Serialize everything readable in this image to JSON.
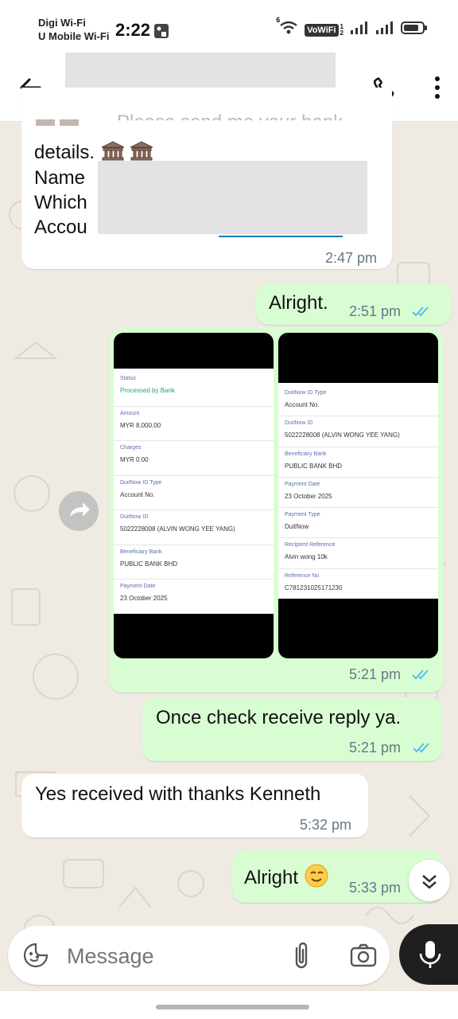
{
  "status_bar": {
    "carrier_line1": "Digi Wi-Fi",
    "carrier_line2": "U Mobile Wi-Fi",
    "time": "2:22",
    "vowifi_badge": "VoWiFi",
    "sim_indicator": "1",
    "sim_indicator2": "2",
    "wifi_sup": "6"
  },
  "app_bar": {
    "back_icon": "arrow-left-icon",
    "call_icon": "phone-icon",
    "menu_icon": "more-vert-icon"
  },
  "messages": {
    "first": {
      "partial_top": "Please send me your bank",
      "line1": "details.",
      "line2": "Name",
      "line3": "Which",
      "line4": "Accou",
      "time": "2:47 pm"
    },
    "alright1": {
      "text": "Alright.",
      "time": "2:51 pm"
    },
    "images": {
      "time": "5:21 pm",
      "left_fields": [
        {
          "label": "Status",
          "value": "Processed by Bank"
        },
        {
          "label": "Amount",
          "value": "MYR 8,000.00"
        },
        {
          "label": "Charges",
          "value": "MYR 0.00"
        },
        {
          "label": "DuitNow ID Type",
          "value": "Account No."
        },
        {
          "label": "DuitNow ID",
          "value": "5022228008 (ALVIN WONG YEE YANG)"
        },
        {
          "label": "Beneficiary Bank",
          "value": "PUBLIC BANK BHD"
        },
        {
          "label": "Payment Date",
          "value": "23 October 2025"
        }
      ],
      "right_fields": [
        {
          "label": "DuitNow ID Type",
          "value": "Account No."
        },
        {
          "label": "DuitNow ID",
          "value": "5022228008 (ALVIN WONG YEE YANG)"
        },
        {
          "label": "Beneficiary Bank",
          "value": "PUBLIC BANK BHD"
        },
        {
          "label": "Payment Date",
          "value": "23 October 2025"
        },
        {
          "label": "Payment Type",
          "value": "DuitNow"
        },
        {
          "label": "Recipient Reference",
          "value": "Alvin wong 10k"
        },
        {
          "label": "Reference No",
          "value": "C781231025171230"
        }
      ]
    },
    "check": {
      "text": "Once check receive reply ya.",
      "time": "5:21 pm"
    },
    "received": {
      "text": "Yes received with thanks Kenneth",
      "time": "5:32 pm"
    },
    "alright2": {
      "text": "Alright",
      "time": "5:33 pm"
    }
  },
  "input": {
    "placeholder": "Message",
    "emoji_icon": "sticker-icon",
    "attach_icon": "paperclip-icon",
    "camera_icon": "camera-icon",
    "mic_icon": "mic-icon"
  },
  "colors": {
    "outgoing_bubble": "#d9fdd3",
    "incoming_bubble": "#ffffff",
    "read_ticks": "#53bdeb",
    "chat_background": "#efeae2",
    "processed_status": "#2e9d6b"
  }
}
